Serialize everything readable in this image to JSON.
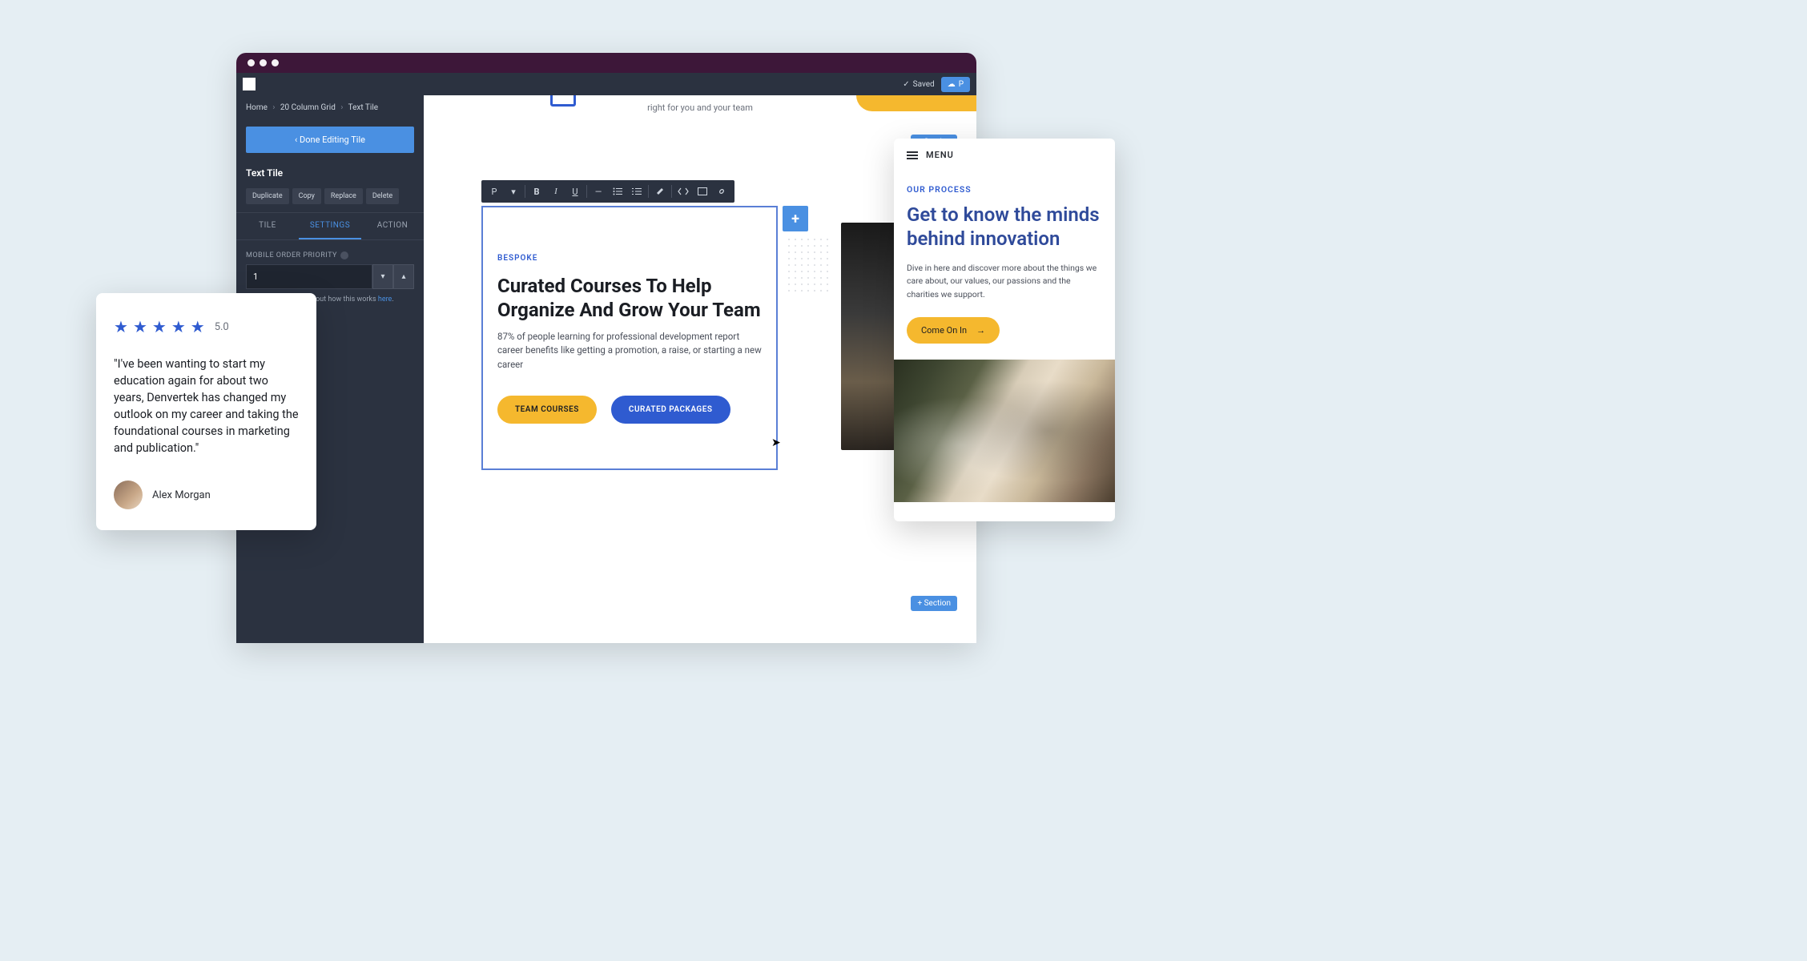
{
  "appbar": {
    "saved_label": "Saved",
    "publish_label": "P"
  },
  "breadcrumb": {
    "home": "Home",
    "grid": "20 Column Grid",
    "tile": "Text Tile"
  },
  "sidebar": {
    "done_label": "‹   Done Editing Tile",
    "section_title": "Text Tile",
    "buttons": {
      "duplicate": "Duplicate",
      "copy": "Copy",
      "replace": "Replace",
      "delete": "Delete"
    },
    "tabs": {
      "tile": "TILE",
      "settings": "SETTINGS",
      "action": "ACTION"
    },
    "mobile_order_label": "MOBILE ORDER PRIORITY",
    "mobile_order_value": "1",
    "hint_prefix": "You can read more about how this works ",
    "hint_link": "here"
  },
  "canvas": {
    "top_fragment": "right for you and your team",
    "section_btn": "+ Section",
    "add_tile": "+",
    "rte": {
      "p": "P",
      "caret": "▾",
      "bold": "B",
      "italic": "I",
      "underline": "U",
      "minus": "—"
    },
    "tile": {
      "eyebrow": "BESPOKE",
      "heading": "Curated Courses To Help Organize And Grow Your Team",
      "body": "87% of people learning for professional development report career benefits like getting a promotion, a raise, or starting a new career",
      "btn_team": "TEAM COURSES",
      "btn_curated": "CURATED PACKAGES"
    }
  },
  "review": {
    "rating": "5.0",
    "text": "\"I've been wanting to start my education again for about two years, Denvertek has changed my outlook on my career and taking the foundational courses in marketing and publication.\"",
    "name": "Alex Morgan"
  },
  "mobile": {
    "menu": "MENU",
    "eyebrow": "OUR PROCESS",
    "heading": "Get to know the minds behind innovation",
    "body": "Dive in here and discover more about the things we care about, our values, our passions and the charities we support.",
    "cta": "Come On In",
    "arrow": "→"
  }
}
